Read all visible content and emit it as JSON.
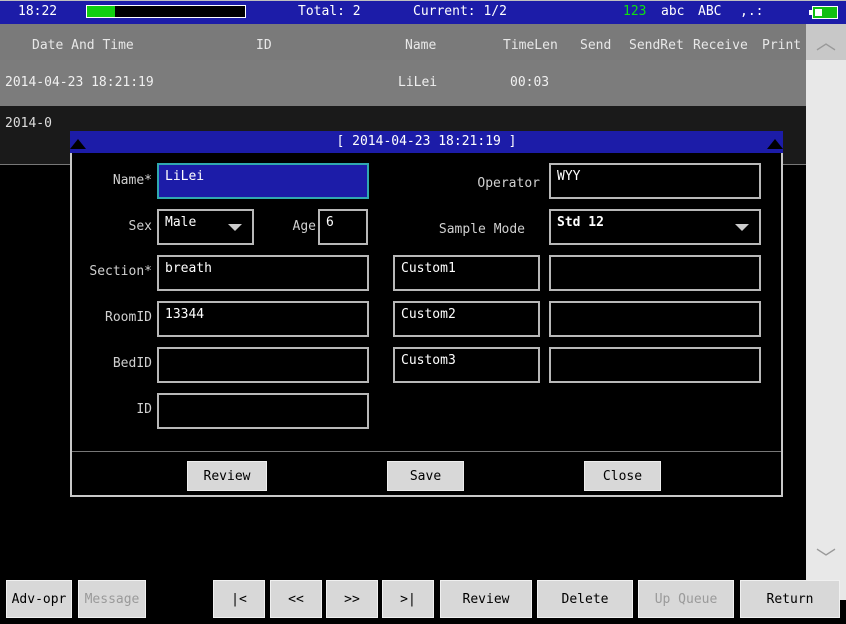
{
  "status": {
    "time": "18:22",
    "total": "Total: 2",
    "current": "Current: 1/2",
    "ime_num": "123",
    "ime_lower": "abc",
    "ime_upper": "ABC",
    "ime_punct": ",.:",
    "progress_fraction": 0.18,
    "colors": {
      "bar": "#1c1ca8",
      "progress": "#10d010",
      "ime_num": "#10e010"
    }
  },
  "table": {
    "headers": [
      "Date And Time",
      "ID",
      "Name",
      "TimeLen",
      "Send",
      "SendRet",
      "Receive",
      "Print"
    ],
    "rows": [
      {
        "datetime": "2014-04-23 18:21:19",
        "id": "",
        "name": "LiLei",
        "timelen": "00:03"
      },
      {
        "datetime": "2014-0",
        "id": "",
        "name": "",
        "timelen": ""
      }
    ]
  },
  "dialog": {
    "title": "[ 2014-04-23 18:21:19 ]",
    "labels": {
      "name": "Name*",
      "sex": "Sex",
      "age": "Age",
      "section": "Section*",
      "roomid": "RoomID",
      "bedid": "BedID",
      "id": "ID",
      "operator": "Operator",
      "sample_mode": "Sample Mode"
    },
    "values": {
      "name": "LiLei",
      "sex": "Male",
      "age": "6",
      "section": "breath",
      "roomid": "13344",
      "bedid": "",
      "id": "",
      "operator": "WYY",
      "sample_mode": "Std 12",
      "custom1": "Custom1",
      "custom1_val": "",
      "custom2": "Custom2",
      "custom2_val": "",
      "custom3": "Custom3",
      "custom3_val": ""
    },
    "buttons": {
      "review": "Review",
      "save": "Save",
      "close": "Close"
    }
  },
  "toolbar": {
    "adv_opr": "Adv-opr",
    "message": "Message",
    "first": "|<",
    "prev": "<<",
    "next": ">>",
    "last": ">|",
    "review": "Review",
    "delete": "Delete",
    "up_queue": "Up Queue",
    "return": "Return"
  }
}
